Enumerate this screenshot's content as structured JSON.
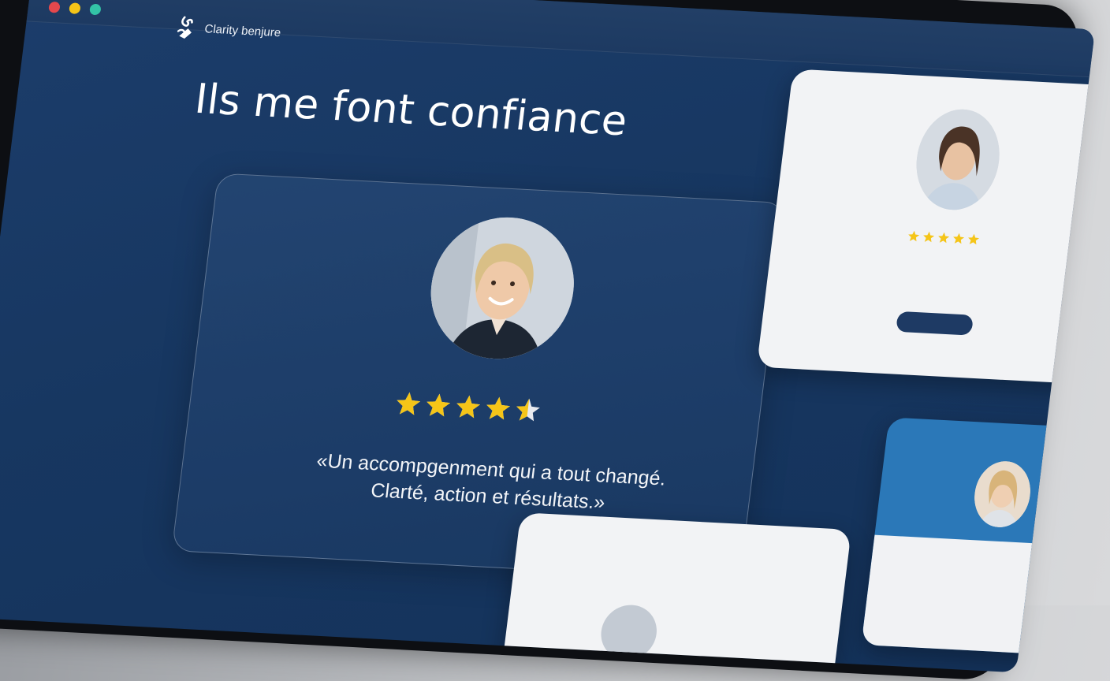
{
  "window": {
    "controls": [
      "close",
      "minimize",
      "maximize"
    ]
  },
  "brand": {
    "name": "Clarity benjure",
    "logo_icon": "brand-logo-icon"
  },
  "hero": {
    "title": "Ils me font confiance"
  },
  "testimonials": {
    "featured": {
      "rating": 4.5,
      "rating_max": 5,
      "quote": "«Un accompgenment qui a tout changé. Clarté, action et résultats.»"
    },
    "side": {
      "rating": 5,
      "quote": "",
      "button_label": ""
    },
    "blue": {
      "quote": ""
    },
    "bottom": {}
  },
  "colors": {
    "background": "#173761",
    "star": "#f5c518",
    "close": "#e5484d",
    "minimize": "#f5c518",
    "maximize": "#33c3a6",
    "side_card": "#f2f3f5",
    "accent_blue": "#2b78b8",
    "button": "#1e3a64"
  }
}
